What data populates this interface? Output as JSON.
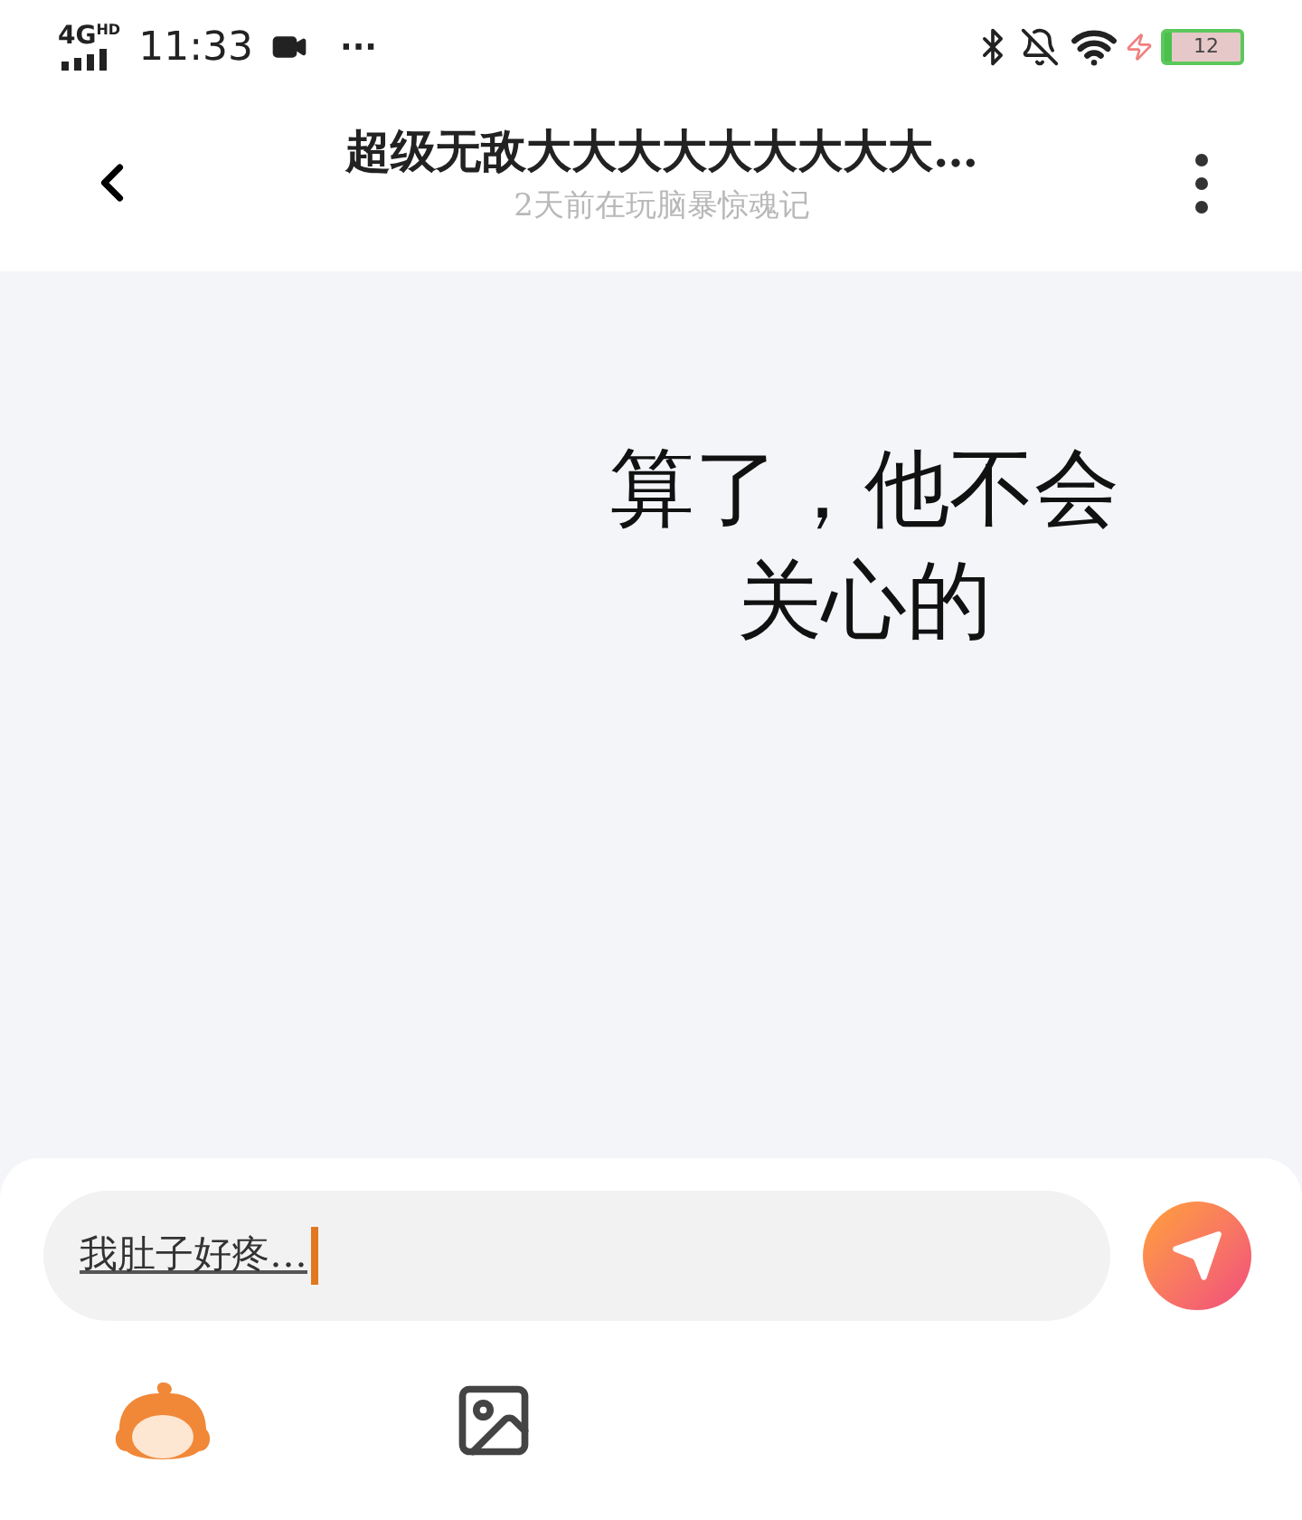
{
  "status_bar": {
    "network": "4G",
    "network_badge": "HD",
    "time": "11:33",
    "more": "···",
    "battery": "12"
  },
  "header": {
    "title": "超级无敌大大大大大大大大大…",
    "subtitle": "2天前在玩脑暴惊魂记"
  },
  "message": {
    "text": "算了，他不会关心的"
  },
  "composer": {
    "value": "我肚子好疼…"
  }
}
